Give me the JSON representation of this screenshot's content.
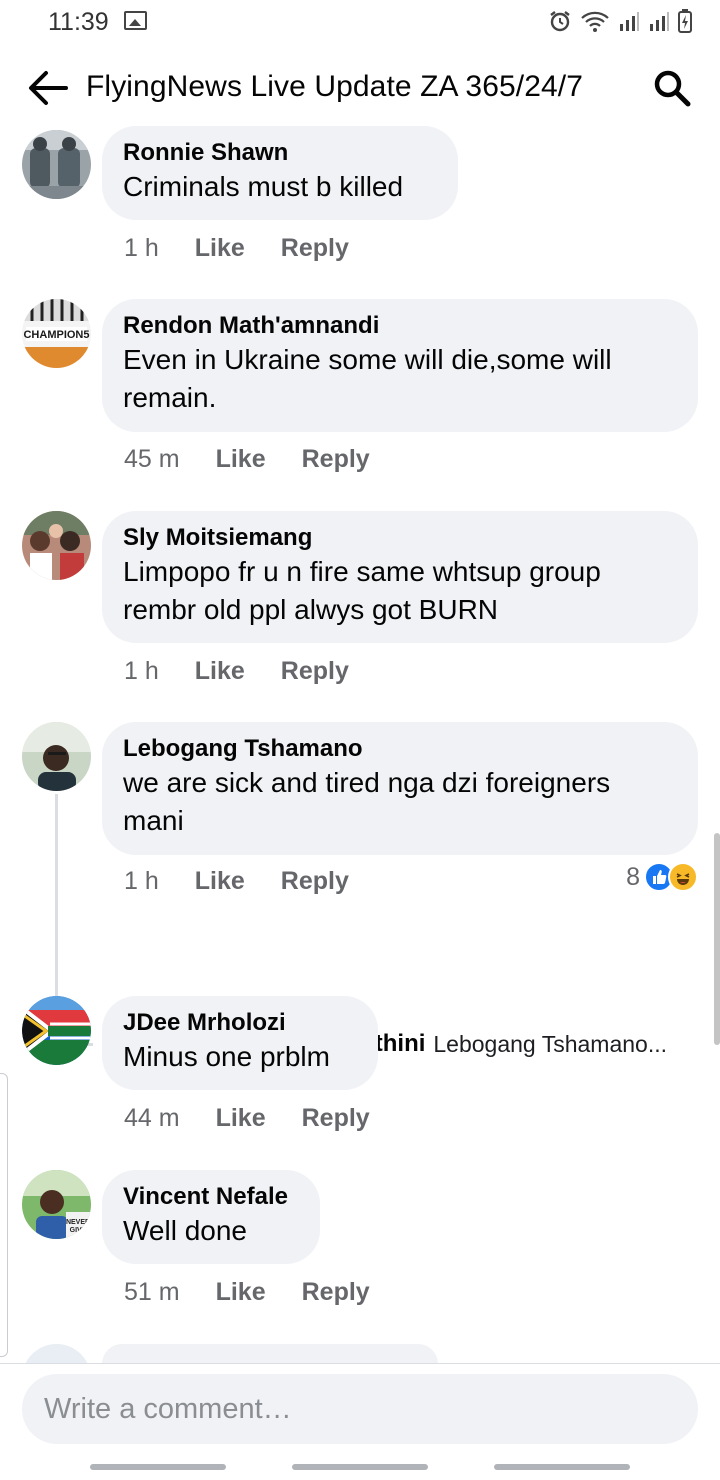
{
  "status_bar": {
    "time": "11:39",
    "icons": [
      "image-icon",
      "alarm-icon",
      "wifi-icon",
      "signal-icon",
      "signal-icon",
      "battery-charging-icon"
    ]
  },
  "header": {
    "title": "FlyingNews Live Update ZA 365/24/7",
    "back_icon": "back-arrow-icon",
    "search_icon": "search-icon"
  },
  "comments": [
    {
      "author": "Ronnie Shawn",
      "text": "Criminals must b killed",
      "time": "1 h",
      "like_label": "Like",
      "reply_label": "Reply"
    },
    {
      "author": "Rendon Math'amnandi",
      "text": "Even in Ukraine some will die,some will remain.",
      "time": "45 m",
      "like_label": "Like",
      "reply_label": "Reply"
    },
    {
      "author": "Sly Moitsiemang",
      "text": "Limpopo fr u n fire same whtsup group rembr old ppl alwys got BURN",
      "time": "1 h",
      "like_label": "Like",
      "reply_label": "Reply"
    },
    {
      "author": "Lebogang Tshamano",
      "text": "we are sick and tired nga dzi foreigners mani",
      "time": "1 h",
      "like_label": "Like",
      "reply_label": "Reply",
      "reaction_count": "8",
      "reaction_icons": [
        "like-reaction-icon",
        "haha-reaction-icon"
      ],
      "reply_preview": {
        "author": "Xabhashe Makhathini",
        "text": "Lebogang Tshamano..."
      }
    },
    {
      "author": "JDee Mrholozi",
      "text": "Minus one prblm",
      "time": "44 m",
      "like_label": "Like",
      "reply_label": "Reply"
    },
    {
      "author": "Vincent Nefale",
      "text": "Well done",
      "time": "51 m",
      "like_label": "Like",
      "reply_label": "Reply"
    }
  ],
  "composer": {
    "placeholder": "Write a comment…"
  },
  "colors": {
    "bubble": "#f0f2f5",
    "meta_text": "#65676b",
    "like_blue": "#1877f2",
    "haha_yellow": "#f7b928"
  }
}
